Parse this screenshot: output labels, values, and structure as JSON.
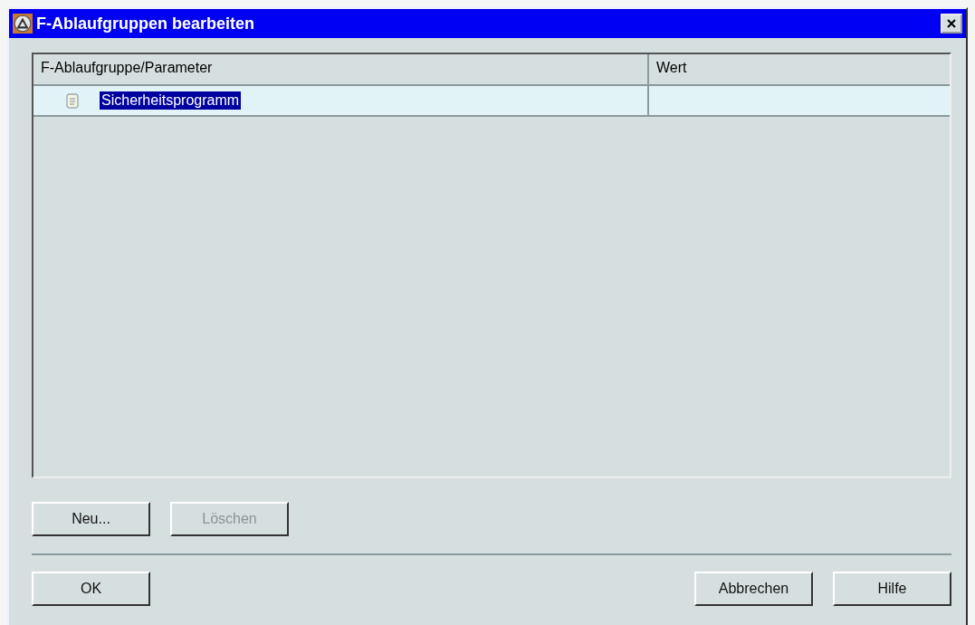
{
  "window": {
    "title": "F-Ablaufgruppen bearbeiten"
  },
  "table": {
    "columns": [
      "F-Ablaufgruppe/Parameter",
      "Wert"
    ],
    "rows": [
      {
        "name": "Sicherheitsprogramm",
        "selected": true
      }
    ]
  },
  "list_buttons": [
    {
      "label": "Neu...",
      "disabled": false
    },
    {
      "label": "Löschen",
      "disabled": true
    }
  ],
  "dialog_buttons_left": [
    "OK"
  ],
  "dialog_buttons_right": [
    "Abbrechen",
    "Hilfe"
  ]
}
